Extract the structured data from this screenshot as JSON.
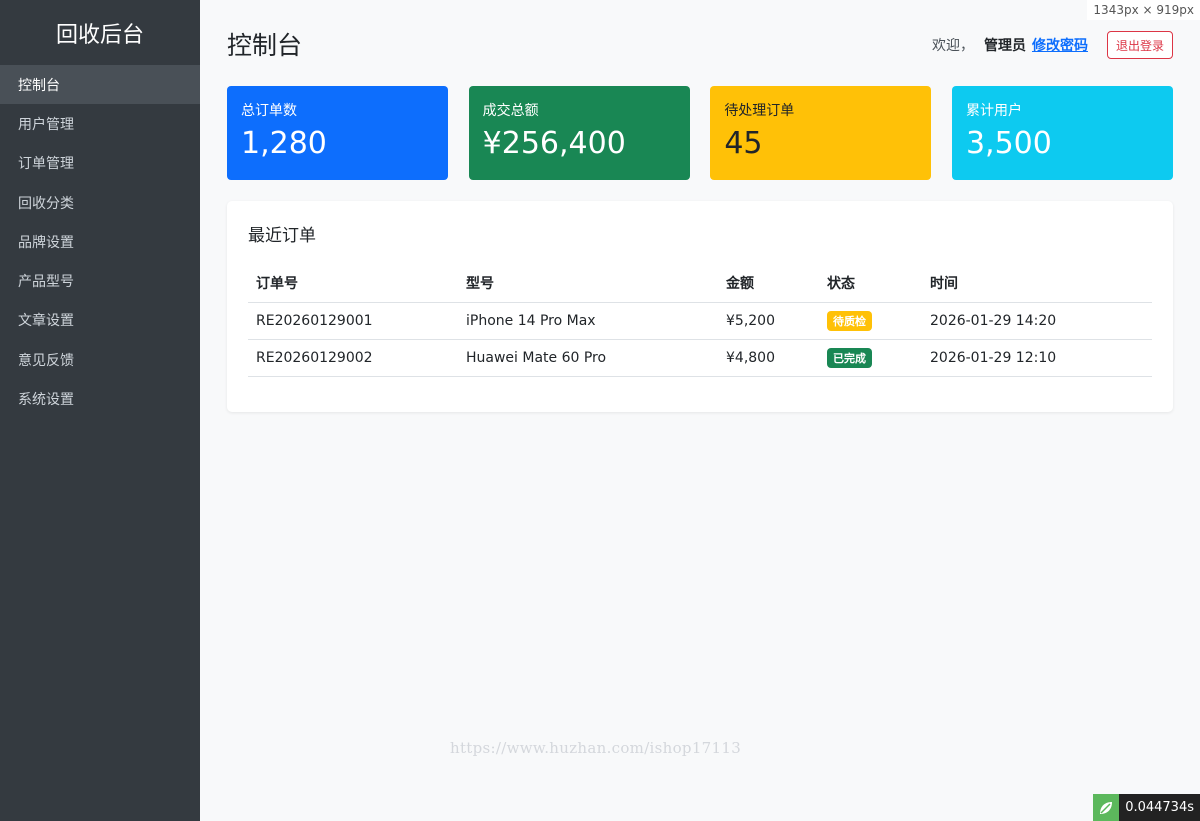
{
  "window": {
    "dimension_tag": "1343px × 919px"
  },
  "sidebar": {
    "brand": "回收后台",
    "items": [
      {
        "label": "控制台",
        "active": true
      },
      {
        "label": "用户管理",
        "active": false
      },
      {
        "label": "订单管理",
        "active": false
      },
      {
        "label": "回收分类",
        "active": false
      },
      {
        "label": "品牌设置",
        "active": false
      },
      {
        "label": "产品型号",
        "active": false
      },
      {
        "label": "文章设置",
        "active": false
      },
      {
        "label": "意见反馈",
        "active": false
      },
      {
        "label": "系统设置",
        "active": false
      }
    ]
  },
  "header": {
    "title": "控制台",
    "welcome": "欢迎，",
    "admin": "管理员",
    "change_password": "修改密码",
    "logout": "退出登录"
  },
  "stats": [
    {
      "label": "总订单数",
      "value": "1,280",
      "color": "#0d6efd",
      "text_color": "#ffffff"
    },
    {
      "label": "成交总额",
      "value": "¥256,400",
      "color": "#198754",
      "text_color": "#ffffff"
    },
    {
      "label": "待处理订单",
      "value": "45",
      "color": "#ffc107",
      "text_color": "#212529"
    },
    {
      "label": "累计用户",
      "value": "3,500",
      "color": "#0dcaf0",
      "text_color": "#ffffff"
    }
  ],
  "recent_orders": {
    "title": "最近订单",
    "columns": [
      "订单号",
      "型号",
      "金额",
      "状态",
      "时间"
    ],
    "rows": [
      {
        "order_no": "RE20260129001",
        "model": "iPhone 14 Pro Max",
        "amount": "¥5,200",
        "status": "待质检",
        "status_color": "#ffc107",
        "time": "2026-01-29 14:20"
      },
      {
        "order_no": "RE20260129002",
        "model": "Huawei Mate 60 Pro",
        "amount": "¥4,800",
        "status": "已完成",
        "status_color": "#198754",
        "time": "2026-01-29 12:10"
      }
    ]
  },
  "watermark": "https://www.huzhan.com/ishop17113",
  "timer": "0.044734s",
  "icons": {
    "timer_logo": "leaf-logo-icon"
  }
}
